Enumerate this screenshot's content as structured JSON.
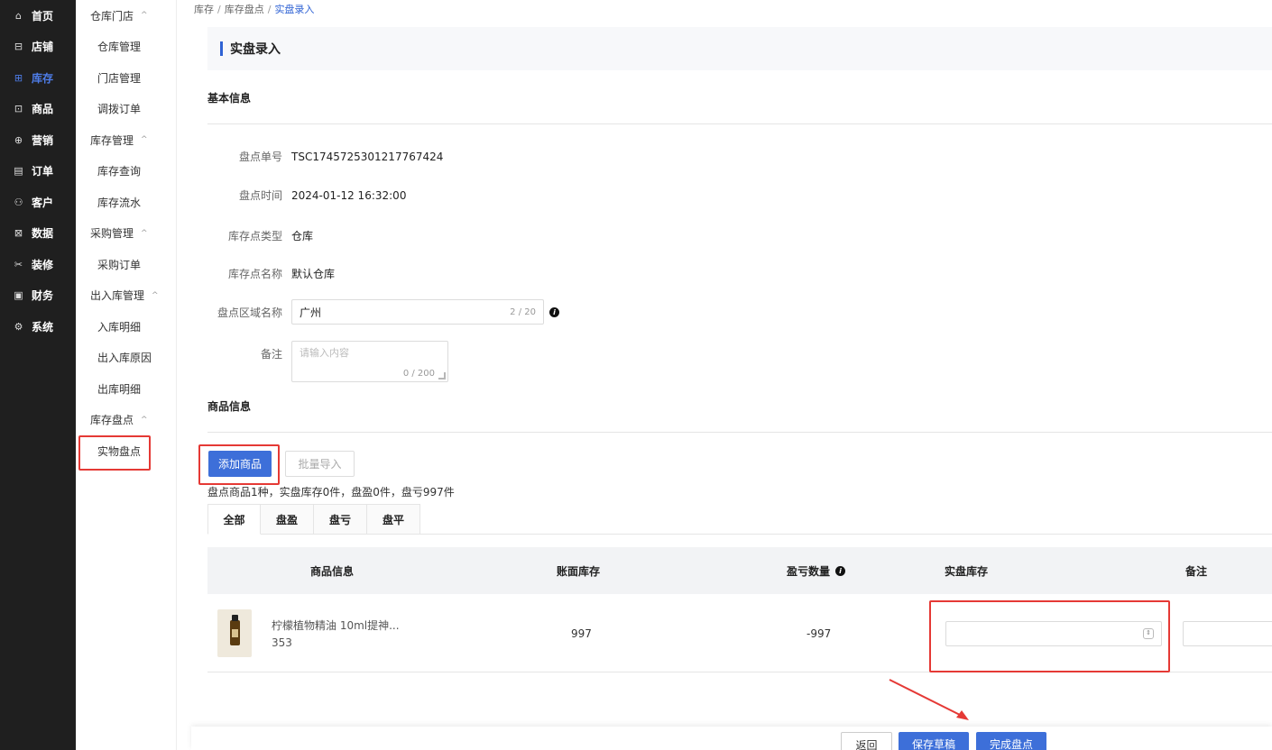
{
  "nav_primary": [
    {
      "icon": "home-icon",
      "glyph": "⌂",
      "label": "首页",
      "active": false
    },
    {
      "icon": "shop-icon",
      "glyph": "⊟",
      "label": "店铺",
      "active": false
    },
    {
      "icon": "inventory-icon",
      "glyph": "⊞",
      "label": "库存",
      "active": true
    },
    {
      "icon": "product-icon",
      "glyph": "⊡",
      "label": "商品",
      "active": false
    },
    {
      "icon": "gift-icon",
      "glyph": "⊕",
      "label": "营销",
      "active": false
    },
    {
      "icon": "order-icon",
      "glyph": "▤",
      "label": "订单",
      "active": false
    },
    {
      "icon": "customer-icon",
      "glyph": "⚇",
      "label": "客户",
      "active": false
    },
    {
      "icon": "data-icon",
      "glyph": "⊠",
      "label": "数据",
      "active": false
    },
    {
      "icon": "decor-icon",
      "glyph": "✂",
      "label": "装修",
      "active": false
    },
    {
      "icon": "finance-icon",
      "glyph": "▣",
      "label": "财务",
      "active": false
    },
    {
      "icon": "system-icon",
      "glyph": "⚙",
      "label": "系统",
      "active": false
    }
  ],
  "nav_secondary": [
    {
      "type": "group",
      "label": "仓库门店"
    },
    {
      "type": "item",
      "label": "仓库管理"
    },
    {
      "type": "item",
      "label": "门店管理"
    },
    {
      "type": "item",
      "label": "调拨订单"
    },
    {
      "type": "group",
      "label": "库存管理"
    },
    {
      "type": "item",
      "label": "库存查询"
    },
    {
      "type": "item",
      "label": "库存流水"
    },
    {
      "type": "group",
      "label": "采购管理"
    },
    {
      "type": "item",
      "label": "采购订单"
    },
    {
      "type": "group",
      "label": "出入库管理"
    },
    {
      "type": "item",
      "label": "入库明细"
    },
    {
      "type": "item",
      "label": "出入库原因"
    },
    {
      "type": "item",
      "label": "出库明细"
    },
    {
      "type": "group",
      "label": "库存盘点"
    },
    {
      "type": "item",
      "label": "实物盘点",
      "selected": true
    }
  ],
  "breadcrumb": {
    "a": "库存",
    "b": "库存盘点",
    "current": "实盘录入",
    "sep": "/"
  },
  "page_title": "实盘录入",
  "basic": {
    "title": "基本信息",
    "order_no_label": "盘点单号",
    "order_no": "TSC1745725301217767424",
    "time_label": "盘点时间",
    "time": "2024-01-12 16:32:00",
    "type_label": "库存点类型",
    "type": "仓库",
    "name_label": "库存点名称",
    "name": "默认仓库",
    "area_label": "盘点区域名称",
    "area_value": "广州",
    "area_count": "2 / 20",
    "remark_label": "备注",
    "remark_placeholder": "请输入内容",
    "remark_count": "0 / 200"
  },
  "goods": {
    "title": "商品信息",
    "add_btn": "添加商品",
    "import_btn": "批量导入",
    "summary": "盘点商品1种，实盘库存0件，盘盈0件，盘亏997件",
    "tabs": [
      "全部",
      "盘盈",
      "盘亏",
      "盘平"
    ],
    "columns": [
      "商品信息",
      "账面库存",
      "盈亏数量",
      "实盘库存",
      "备注"
    ],
    "rows": [
      {
        "name": "柠檬植物精油 10ml提神...",
        "code": "353",
        "book_stock": "997",
        "diff": "-997"
      }
    ]
  },
  "footer": {
    "back": "返回",
    "save_draft": "保存草稿",
    "finish": "完成盘点"
  },
  "colors": {
    "accent": "#3d6fd9",
    "highlight": "#e53935",
    "nav_bg": "#1f1f1f"
  }
}
